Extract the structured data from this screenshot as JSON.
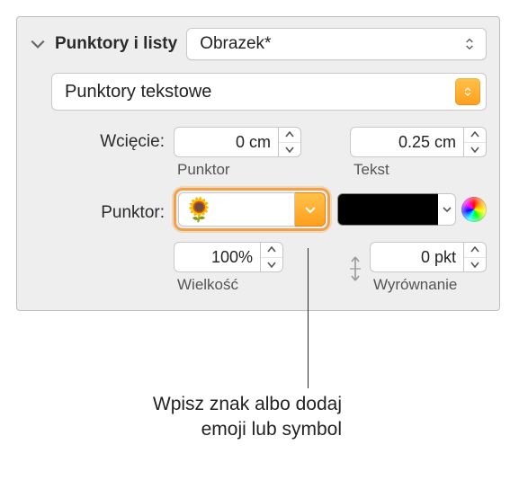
{
  "section": {
    "title": "Punktory i listy"
  },
  "style_popup": {
    "label": "Obrazek*"
  },
  "type_popup": {
    "label": "Punktory tekstowe"
  },
  "indent": {
    "label": "Wcięcie:",
    "bullet_value": "0 cm",
    "bullet_sub": "Punktor",
    "text_value": "0.25 cm",
    "text_sub": "Tekst"
  },
  "bullet": {
    "label": "Punktor:",
    "emoji": "🌻",
    "swatch_color": "#000000"
  },
  "size": {
    "value": "100%",
    "sub": "Wielkość"
  },
  "align": {
    "value": "0 pkt",
    "sub": "Wyrównanie"
  },
  "callout": {
    "line1": "Wpisz znak albo dodaj",
    "line2": "emoji lub symbol"
  }
}
